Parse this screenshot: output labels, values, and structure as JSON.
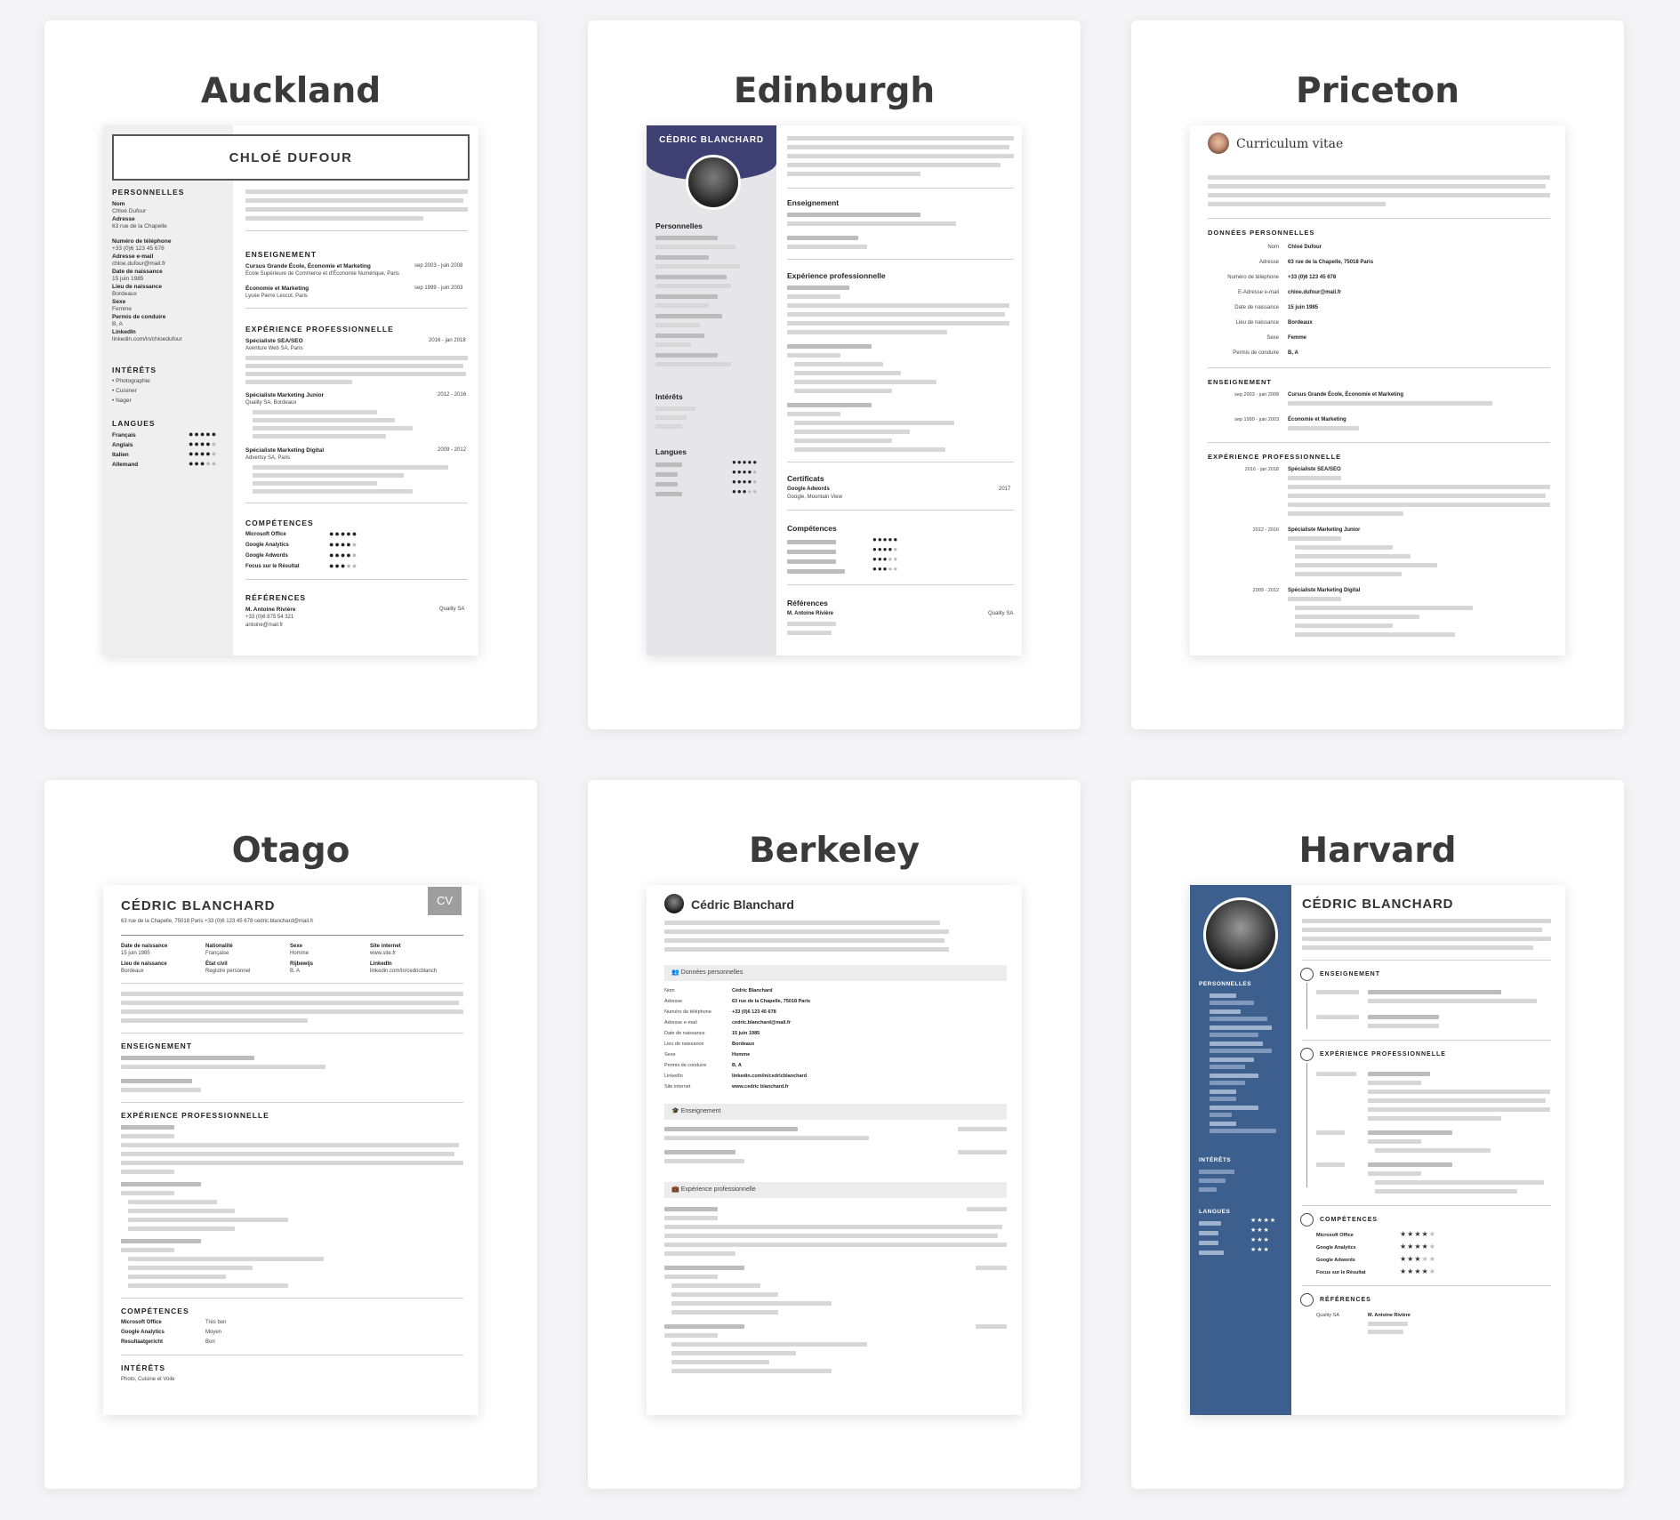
{
  "templates": [
    {
      "title": "Auckland",
      "cv_name": "CHLOÉ DUFOUR",
      "sections": {
        "personnelles": "PERSONNELLES",
        "interets": "INTÉRÊTS",
        "langues": "LANGUES",
        "enseignement": "ENSEIGNEMENT",
        "experience": "EXPÉRIENCE PROFESSIONNELLE",
        "competences": "COMPÉTENCES",
        "references": "RÉFÉRENCES"
      },
      "personal": {
        "nom_label": "Nom",
        "nom_value": "Chloé Dufour",
        "adresse_label": "Adresse",
        "adresse_value": "63 rue de la Chapelle",
        "tel_label": "Numéro de téléphone",
        "tel_value": "+33 (0)6 123 45 678",
        "email_label": "Adresse e-mail",
        "email_value": "chloe.dufour@mail.fr",
        "naissance_label": "Date de naissance",
        "naissance_value": "15 juin 1985",
        "lieu_label": "Lieu de naissance",
        "lieu_value": "Bordeaux",
        "sexe_label": "Sexe",
        "sexe_value": "Femme",
        "permis_label": "Permis de conduire",
        "permis_value": "B, A",
        "linkedin_label": "LinkedIn",
        "linkedin_value": "linkedin.com/in/chloedufour"
      },
      "interests": [
        "Photographie",
        "Cuisiner",
        "Nager"
      ],
      "languages": [
        "Français",
        "Anglais",
        "Italien",
        "Allemand"
      ],
      "language_levels": [
        5,
        4,
        4,
        3
      ],
      "education": [
        {
          "title": "Cursus Grande École, Économie et Marketing",
          "date": "sep 2003 - juin 2008",
          "school": "École Supérieure de Commerce et d'Économie Numérique, Paris"
        },
        {
          "title": "Économie et Marketing",
          "date": "sep 1999 - juin 2003",
          "school": "Lycée Pierre Lescot, Paris"
        }
      ],
      "experience": [
        {
          "title": "Spécialiste SEA/SEO",
          "date": "2016 - jan 2018",
          "company": "Aventure Web SA, Paris"
        },
        {
          "title": "Spécialiste Marketing Junior",
          "date": "2012 - 2016",
          "company": "Quality SA, Bordeaux"
        },
        {
          "title": "Spécialiste Marketing Digital",
          "date": "2009 - 2012",
          "company": "Advertsy SA, Paris"
        }
      ],
      "skills": [
        "Microsoft Office",
        "Google Analytics",
        "Google Adwords",
        "Focus sur le Résultat"
      ],
      "skill_levels": [
        5,
        4,
        4,
        3
      ],
      "reference": {
        "name": "M. Antoine Rivière",
        "phone": "+33 (0)6 875 54 321",
        "email": "antoine@mail.fr",
        "company": "Quality SA"
      }
    },
    {
      "title": "Edinburgh",
      "cv_name": "CÉDRIC BLANCHARD",
      "sections": {
        "personnelles": "Personnelles",
        "interets": "Intérêts",
        "langues": "Langues",
        "enseignement": "Enseignement",
        "experience": "Expérience professionnelle",
        "certificats": "Certificats",
        "competences": "Compétences",
        "references": "Références"
      },
      "certificate": {
        "title": "Google Adwords",
        "company": "Google, Mountain View",
        "date": "2017"
      },
      "reference_name": "M. Antoine Rivière",
      "reference_company": "Quality SA"
    },
    {
      "title": "Priceton",
      "cv_heading": "Curriculum vitae",
      "sections": {
        "donnees": "DONNÉES PERSONNELLES",
        "enseignement": "ENSEIGNEMENT",
        "experience": "EXPÉRIENCE PROFESSIONNELLE"
      },
      "personal_rows": [
        {
          "label": "Nom",
          "value": "Chloé Dufour"
        },
        {
          "label": "Adresse",
          "value": "63 rue de la Chapelle, 75018 Paris"
        },
        {
          "label": "Numéro de téléphone",
          "value": "+33 (0)6 123 45 678"
        },
        {
          "label": "E-Adresse e-mail",
          "value": "chloe.dufour@mail.fr"
        },
        {
          "label": "Date de naissance",
          "value": "15 juin 1985"
        },
        {
          "label": "Lieu de naissance",
          "value": "Bordeaux"
        },
        {
          "label": "Sexe",
          "value": "Femme"
        },
        {
          "label": "Permis de conduire",
          "value": "B, A"
        }
      ],
      "education": [
        {
          "date": "sep 2003 - juin 2008",
          "title": "Cursus Grande École, Économie et Marketing"
        },
        {
          "date": "sep 1999 - juin 2003",
          "title": "Économie et Marketing"
        }
      ],
      "experience": [
        {
          "date": "2016 - jan 2018",
          "title": "Spécialiste SEA/SEO"
        },
        {
          "date": "2012 - 2016",
          "title": "Spécialiste Marketing Junior"
        },
        {
          "date": "2009 - 2012",
          "title": "Spécialiste Marketing Digital"
        }
      ]
    },
    {
      "title": "Otago",
      "cv_name": "CÉDRIC BLANCHARD",
      "cv_badge": "CV",
      "contact": "63 rue de la Chapelle, 75018 Paris   +33 (0)6 123 45 678   cedric.blanchard@mail.fr",
      "facts": [
        {
          "label": "Date de naissance",
          "value": "15 juin 1985"
        },
        {
          "label": "Nationalité",
          "value": "Française"
        },
        {
          "label": "Sexe",
          "value": "Homme"
        },
        {
          "label": "Site internet",
          "value": "www.site.fr"
        },
        {
          "label": "Lieu de naissance",
          "value": "Bordeaux"
        },
        {
          "label": "État civil",
          "value": "Registre personnel"
        },
        {
          "label": "Rijbewijs",
          "value": "B, A"
        },
        {
          "label": "LinkedIn",
          "value": "linkedin.com/in/cedricblanch"
        }
      ],
      "sections": {
        "enseignement": "ENSEIGNEMENT",
        "experience": "EXPÉRIENCE PROFESSIONNELLE",
        "competences": "COMPÉTENCES",
        "interets": "INTÉRÊTS"
      },
      "skills": [
        {
          "name": "Microsoft Office",
          "level": "Très bon"
        },
        {
          "name": "Google Analytics",
          "level": "Moyen"
        },
        {
          "name": "Resultaatgericht",
          "level": "Bon"
        }
      ],
      "interests_text": "Photo, Cuisine et Voile"
    },
    {
      "title": "Berkeley",
      "cv_name": "Cédric Blanchard",
      "sections": {
        "donnees": "Données personnelles",
        "enseignement": "Enseignement",
        "experience": "Expérience professionnelle"
      },
      "personal_rows": [
        {
          "label": "Nom",
          "value": "Cédric Blanchard"
        },
        {
          "label": "Adresse",
          "value": "63 rue de la Chapelle, 75018 Paris"
        },
        {
          "label": "Numéro de téléphone",
          "value": "+33 (0)6 123 45 678"
        },
        {
          "label": "Adresse e-mail",
          "value": "cedric.blanchard@mail.fr"
        },
        {
          "label": "Date de naissance",
          "value": "15 juin 1985"
        },
        {
          "label": "Lieu de naissance",
          "value": "Bordeaux"
        },
        {
          "label": "Sexe",
          "value": "Homme"
        },
        {
          "label": "Permis de conduire",
          "value": "B, A"
        },
        {
          "label": "LinkedIn",
          "value": "linkedin.com/in/cedricblanchard"
        },
        {
          "label": "Site internet",
          "value": "www.cedric blanchard.fr"
        }
      ]
    },
    {
      "title": "Harvard",
      "cv_name": "CÉDRIC BLANCHARD",
      "sections": {
        "personnelles": "PERSONNELLES",
        "interets": "INTÉRÊTS",
        "langues": "LANGUES",
        "enseignement": "ENSEIGNEMENT",
        "experience": "EXPÉRIENCE PROFESSIONNELLE",
        "competences": "COMPÉTENCES",
        "references": "RÉFÉRENCES"
      },
      "skills": [
        "Microsoft Office",
        "Google Analytics",
        "Google Adwords",
        "Focus sur le Résultat"
      ],
      "reference_name": "M. Antoine Rivière",
      "reference_company": "Quality SA"
    }
  ],
  "colors": {
    "edinburgh_header": "#3e3f73",
    "harvard_sidebar": "#3c5f8d",
    "otago_badge": "#9e9e9e"
  }
}
